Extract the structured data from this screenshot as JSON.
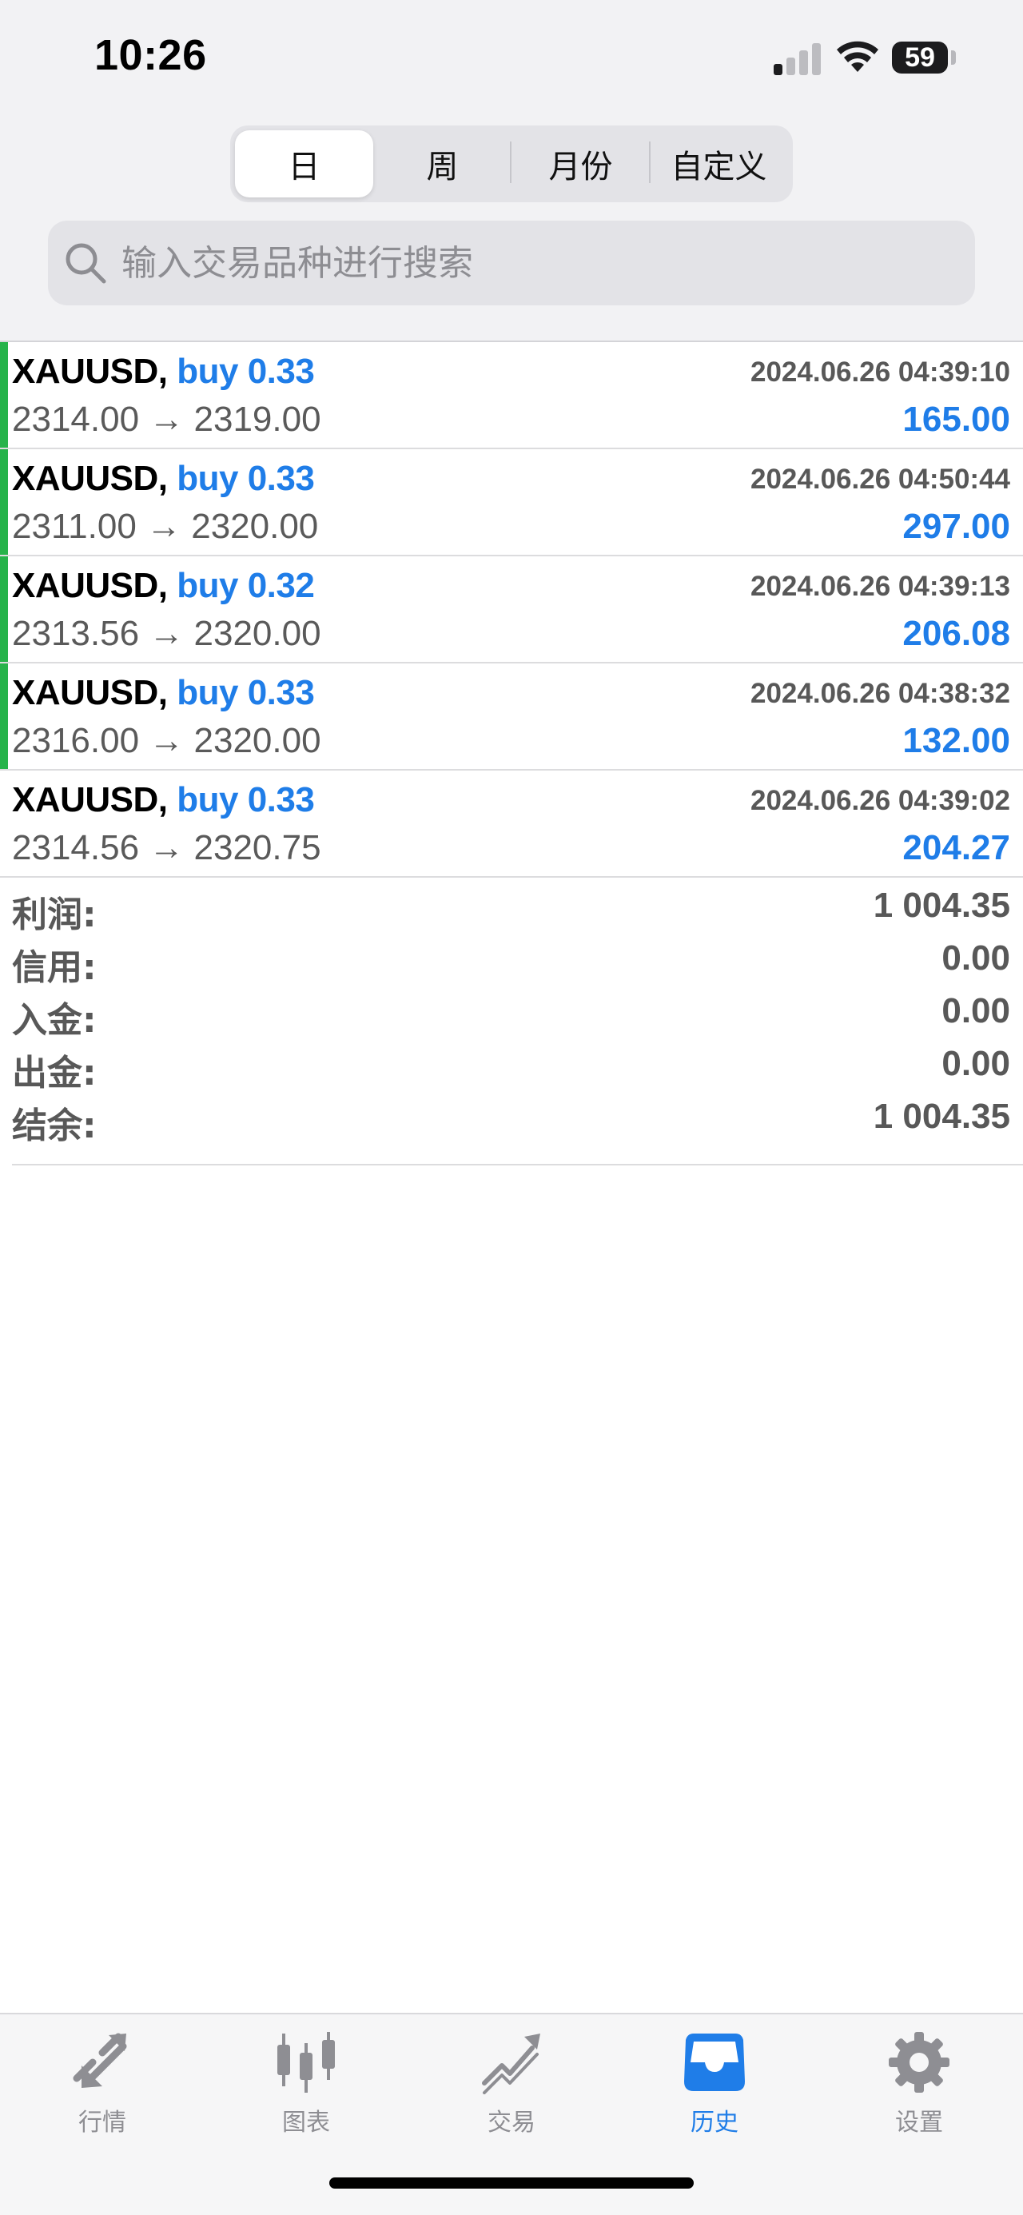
{
  "status_bar": {
    "time": "10:26",
    "battery": "59"
  },
  "segmented": {
    "tabs": [
      {
        "label": "日",
        "active": true
      },
      {
        "label": "周",
        "active": false
      },
      {
        "label": "月份",
        "active": false
      },
      {
        "label": "自定义",
        "active": false
      }
    ]
  },
  "search": {
    "placeholder": "输入交易品种进行搜索"
  },
  "trades": [
    {
      "symbol": "XAUUSD,",
      "side": "buy 0.33",
      "time": "2024.06.26 04:39:10",
      "prices": "2314.00 → 2319.00",
      "profit": "165.00",
      "accent": true
    },
    {
      "symbol": "XAUUSD,",
      "side": "buy 0.33",
      "time": "2024.06.26 04:50:44",
      "prices": "2311.00 → 2320.00",
      "profit": "297.00",
      "accent": true
    },
    {
      "symbol": "XAUUSD,",
      "side": "buy 0.32",
      "time": "2024.06.26 04:39:13",
      "prices": "2313.56 → 2320.00",
      "profit": "206.08",
      "accent": true
    },
    {
      "symbol": "XAUUSD,",
      "side": "buy 0.33",
      "time": "2024.06.26 04:38:32",
      "prices": "2316.00 → 2320.00",
      "profit": "132.00",
      "accent": true
    },
    {
      "symbol": "XAUUSD,",
      "side": "buy 0.33",
      "time": "2024.06.26 04:39:02",
      "prices": "2314.56 → 2320.75",
      "profit": "204.27",
      "accent": false
    }
  ],
  "summary": [
    {
      "label": "利润:",
      "value": "1 004.35"
    },
    {
      "label": "信用:",
      "value": "0.00"
    },
    {
      "label": "入金:",
      "value": "0.00"
    },
    {
      "label": "出金:",
      "value": "0.00"
    },
    {
      "label": "结余:",
      "value": "1 004.35"
    }
  ],
  "tabbar": {
    "items": [
      {
        "label": "行情",
        "icon": "quotes-icon",
        "active": false
      },
      {
        "label": "图表",
        "icon": "candlestick-chart-icon",
        "active": false
      },
      {
        "label": "交易",
        "icon": "trade-icon",
        "active": false
      },
      {
        "label": "历史",
        "icon": "history-inbox-icon",
        "active": true
      },
      {
        "label": "设置",
        "icon": "gear-icon",
        "active": false
      }
    ]
  },
  "colors": {
    "accent_blue": "#1f7de8",
    "accent_green": "#26b34a",
    "inactive_gray": "#8e8e93"
  }
}
